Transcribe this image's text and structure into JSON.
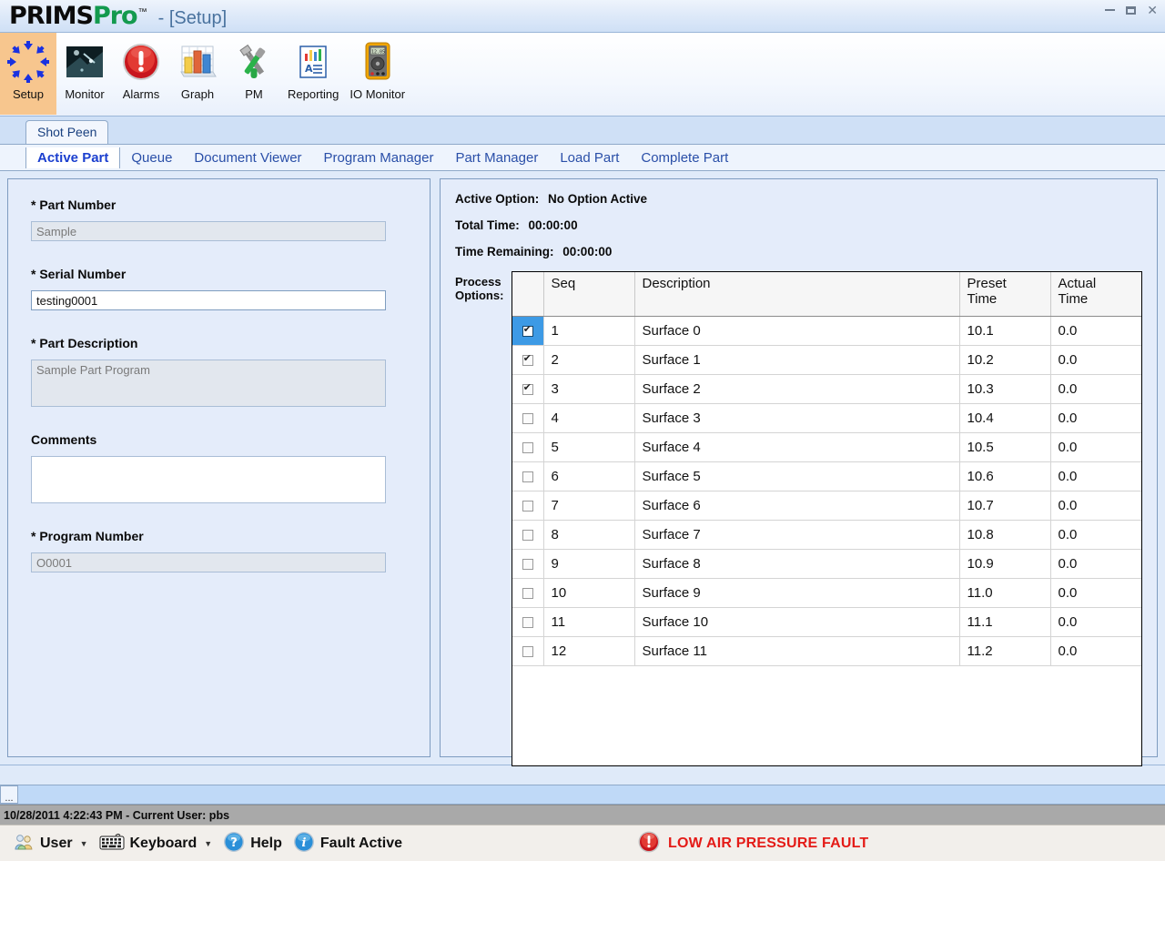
{
  "window": {
    "brand_part1": "PRIMS",
    "brand_part2": "Pro",
    "trademark": "™",
    "subtitle": "- [Setup]",
    "controls": {
      "minimize": "minimize-icon",
      "restore": "restore-icon",
      "close": "✕"
    }
  },
  "toolbar": {
    "items": [
      {
        "label": "Setup",
        "icon": "setup-arrows-circle-icon",
        "selected": true
      },
      {
        "label": "Monitor",
        "icon": "monitor-photo-icon",
        "selected": false
      },
      {
        "label": "Alarms",
        "icon": "alarm-exclamation-icon",
        "selected": false
      },
      {
        "label": "Graph",
        "icon": "bar-chart-icon",
        "selected": false
      },
      {
        "label": "PM",
        "icon": "wrench-screwdriver-icon",
        "selected": false
      },
      {
        "label": "Reporting",
        "icon": "report-document-icon",
        "selected": false
      },
      {
        "label": "IO Monitor",
        "icon": "multimeter-icon",
        "selected": false
      }
    ]
  },
  "tabs": {
    "top": [
      {
        "label": "Shot Peen",
        "selected": true
      }
    ],
    "sub": [
      {
        "label": "Active Part",
        "selected": true
      },
      {
        "label": "Queue",
        "selected": false
      },
      {
        "label": "Document Viewer",
        "selected": false
      },
      {
        "label": "Program Manager",
        "selected": false
      },
      {
        "label": "Part Manager",
        "selected": false
      },
      {
        "label": "Load Part",
        "selected": false
      },
      {
        "label": "Complete Part",
        "selected": false
      }
    ]
  },
  "left_panel": {
    "part_number_label": "* Part Number",
    "part_number_value": "Sample",
    "serial_number_label": "* Serial Number",
    "serial_number_value": "testing0001",
    "part_description_label": "* Part Description",
    "part_description_value": "Sample Part Program",
    "comments_label": "Comments",
    "comments_value": "",
    "program_number_label": "* Program Number",
    "program_number_value": "O0001"
  },
  "right_panel": {
    "active_option_label": "Active Option:",
    "active_option_value": "No Option Active",
    "total_time_label": "Total Time:",
    "total_time_value": "00:00:00",
    "time_remaining_label": "Time Remaining:",
    "time_remaining_value": "00:00:00",
    "process_options_label": "Process\nOptions:",
    "process_options_label_line1": "Process",
    "process_options_label_line2": "Options:",
    "grid": {
      "columns": [
        {
          "key": "check",
          "header": ""
        },
        {
          "key": "seq",
          "header": "Seq"
        },
        {
          "key": "description",
          "header": "Description"
        },
        {
          "key": "preset_time",
          "header": "Preset\nTime",
          "header_line1": "Preset",
          "header_line2": "Time"
        },
        {
          "key": "actual_time",
          "header": "Actual\nTime",
          "header_line1": "Actual",
          "header_line2": "Time"
        }
      ],
      "rows": [
        {
          "checked": true,
          "selected": true,
          "seq": "1",
          "description": "Surface 0",
          "preset_time": "10.1",
          "actual_time": "0.0"
        },
        {
          "checked": true,
          "selected": false,
          "seq": "2",
          "description": "Surface 1",
          "preset_time": "10.2",
          "actual_time": "0.0"
        },
        {
          "checked": true,
          "selected": false,
          "seq": "3",
          "description": "Surface 2",
          "preset_time": "10.3",
          "actual_time": "0.0"
        },
        {
          "checked": false,
          "selected": false,
          "seq": "4",
          "description": "Surface 3",
          "preset_time": "10.4",
          "actual_time": "0.0"
        },
        {
          "checked": false,
          "selected": false,
          "seq": "5",
          "description": "Surface 4",
          "preset_time": "10.5",
          "actual_time": "0.0"
        },
        {
          "checked": false,
          "selected": false,
          "seq": "6",
          "description": "Surface 5",
          "preset_time": "10.6",
          "actual_time": "0.0"
        },
        {
          "checked": false,
          "selected": false,
          "seq": "7",
          "description": "Surface 6",
          "preset_time": "10.7",
          "actual_time": "0.0"
        },
        {
          "checked": false,
          "selected": false,
          "seq": "8",
          "description": "Surface 7",
          "preset_time": "10.8",
          "actual_time": "0.0"
        },
        {
          "checked": false,
          "selected": false,
          "seq": "9",
          "description": "Surface 8",
          "preset_time": "10.9",
          "actual_time": "0.0"
        },
        {
          "checked": false,
          "selected": false,
          "seq": "10",
          "description": "Surface 9",
          "preset_time": "11.0",
          "actual_time": "0.0"
        },
        {
          "checked": false,
          "selected": false,
          "seq": "11",
          "description": "Surface 10",
          "preset_time": "11.1",
          "actual_time": "0.0"
        },
        {
          "checked": false,
          "selected": false,
          "seq": "12",
          "description": "Surface 11",
          "preset_time": "11.2",
          "actual_time": "0.0"
        }
      ]
    }
  },
  "mini_bar": {
    "expand_button": "..."
  },
  "status_bar": {
    "text": "10/28/2011 4:22:43 PM - Current User:  pbs"
  },
  "bottom_bar": {
    "items": [
      {
        "label": "User",
        "icon": "users-icon",
        "has_caret": true
      },
      {
        "label": "Keyboard",
        "icon": "keyboard-icon",
        "has_caret": true
      },
      {
        "label": "Help",
        "icon": "help-question-icon",
        "has_caret": false
      },
      {
        "label": "Fault Active",
        "icon": "info-icon",
        "has_caret": false
      }
    ],
    "fault": {
      "text": "LOW AIR PRESSURE FAULT",
      "icon": "alarm-exclamation-icon",
      "color": "#e41b17"
    }
  },
  "colors": {
    "accent_blue": "#2a4fa8",
    "selection_blue": "#3d9ae5",
    "brand_green": "#139a4e",
    "panel_bg": "#e4ecfa",
    "toolbar_selected": "#f7c68e",
    "fault_red": "#e41b17"
  }
}
